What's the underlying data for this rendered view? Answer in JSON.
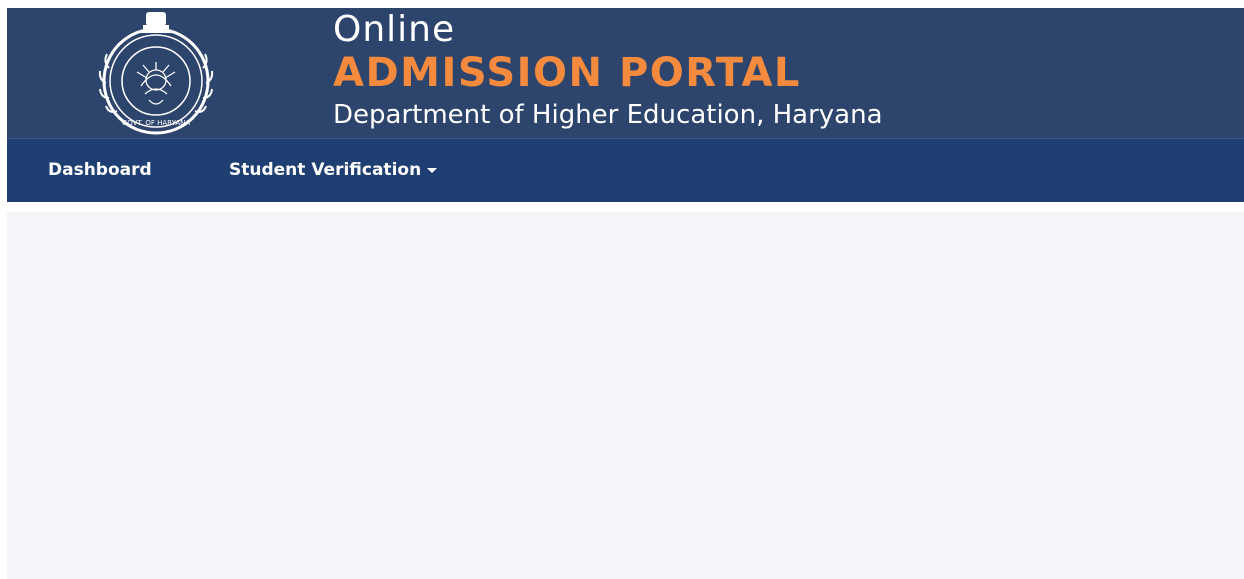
{
  "header": {
    "title_line1": "Online",
    "title_line2": "ADMISSION PORTAL",
    "subtitle": "Department of Higher Education, Haryana",
    "emblem_icon": "haryana-govt-emblem-icon",
    "emblem_text": "GOVT. OF HARYANA",
    "colors": {
      "header_bg": "#2d446c",
      "portal_accent": "#f48a3d"
    }
  },
  "nav": {
    "items": [
      {
        "label": "Dashboard"
      },
      {
        "label": "Student Verification",
        "has_dropdown": true
      }
    ],
    "colors": {
      "nav_bg": "#1f3f72"
    }
  },
  "main": {
    "background": "#f4f5f9"
  }
}
